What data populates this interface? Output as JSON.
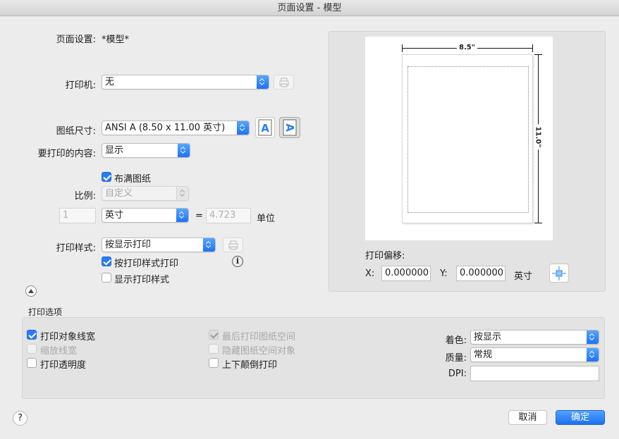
{
  "window": {
    "title": "页面设置 - 模型"
  },
  "page_setup": {
    "label": "页面设置:",
    "value": "*模型*"
  },
  "printer": {
    "label": "打印机:",
    "selected": "无"
  },
  "paper_size": {
    "label": "图纸尺寸:",
    "selected": "ANSI A (8.50 x 11.00 英寸)"
  },
  "print_what": {
    "label": "要打印的内容:",
    "selected": "显示"
  },
  "scale": {
    "fit_label": "布满图纸",
    "label": "比例:",
    "selected": "自定义",
    "num_value": "1",
    "unit_selected": "英寸",
    "equals": "=",
    "units_value": "4.723",
    "units_label": "单位"
  },
  "print_style": {
    "label": "打印样式:",
    "selected": "按显示打印",
    "by_style_label": "按打印样式打印",
    "show_style_label": "显示打印样式"
  },
  "preview": {
    "width_label": "8.5\"",
    "height_label": "11.0\""
  },
  "offset": {
    "label": "打印偏移:",
    "x_label": "X:",
    "x_value": "0.000000",
    "y_label": "Y:",
    "y_value": "0.000000",
    "unit": "英寸"
  },
  "options": {
    "section_label": "打印选项",
    "lineweights": "打印对象线宽",
    "scale_lineweights": "缩放线宽",
    "transparency": "打印透明度",
    "paperspace_last": "最后打印图纸空间",
    "hide_paperspace": "隐藏图纸空间对象",
    "upside_down": "上下颠倒打印",
    "shade_label": "着色:",
    "shade_selected": "按显示",
    "quality_label": "质量:",
    "quality_selected": "常规",
    "dpi_label": "DPI:",
    "dpi_value": ""
  },
  "footer": {
    "help": "?",
    "cancel": "取消",
    "ok": "确定"
  },
  "colors": {
    "accent": "#1c6ff0",
    "panel": "#e3e3e3"
  }
}
